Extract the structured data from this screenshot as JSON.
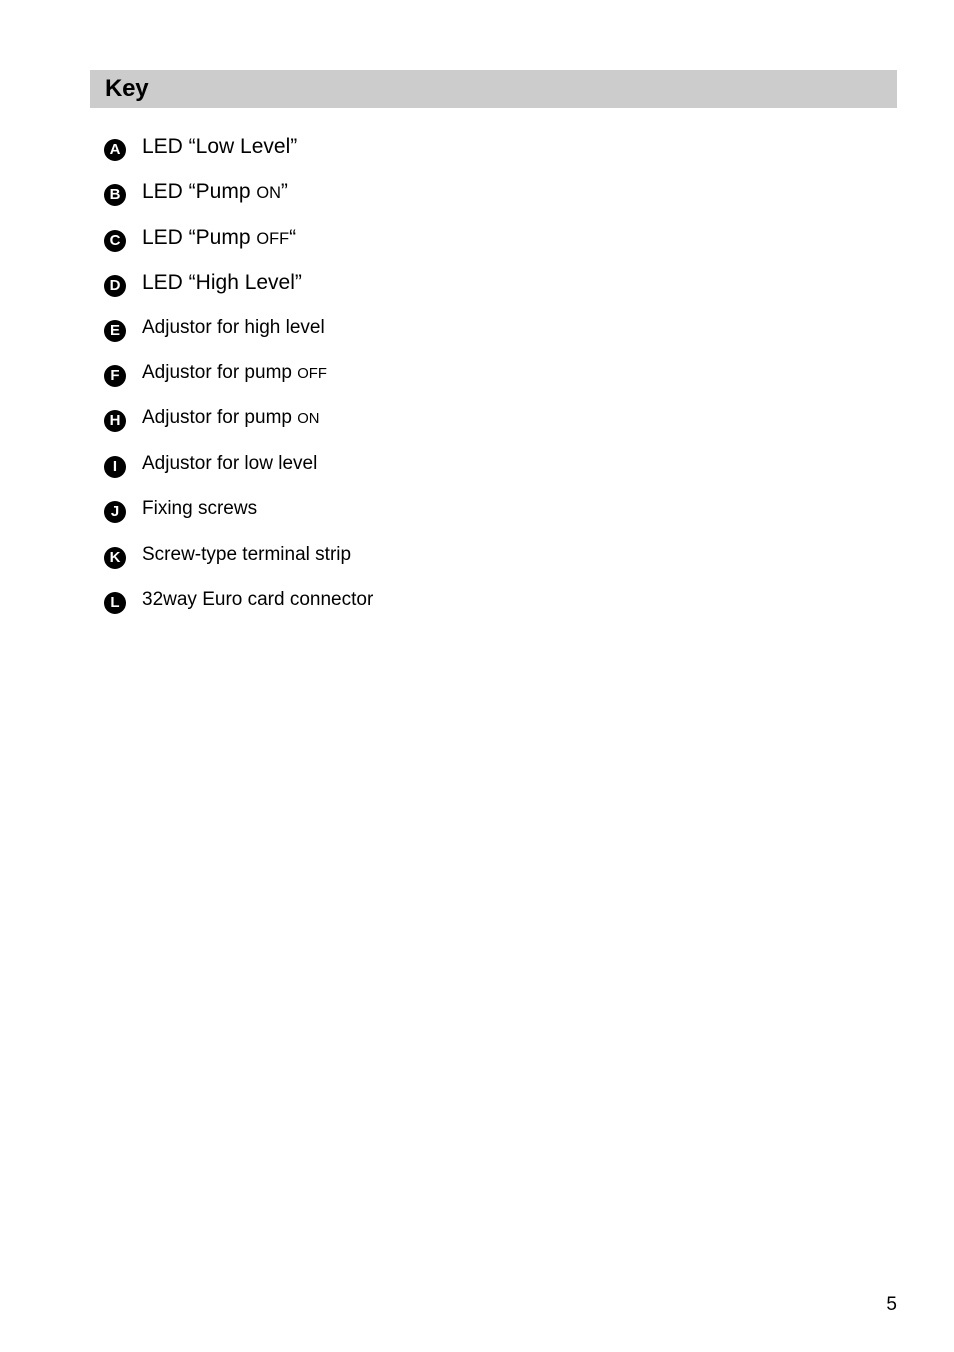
{
  "section": {
    "title": "Key",
    "header_bg": "#cccccc"
  },
  "key_list": [
    {
      "badge": "A",
      "size": "lg",
      "text_before": "LED “Low Level”",
      "smallcaps": "",
      "text_after": ""
    },
    {
      "badge": "B",
      "size": "lg",
      "text_before": "LED “Pump ",
      "smallcaps": "ON",
      "text_after": "”"
    },
    {
      "badge": "C",
      "size": "lg",
      "text_before": "LED “Pump ",
      "smallcaps": "OFF",
      "text_after": "“"
    },
    {
      "badge": "D",
      "size": "lg",
      "text_before": "LED “High Level”",
      "smallcaps": "",
      "text_after": ""
    },
    {
      "badge": "E",
      "size": "sm",
      "text_before": "Adjustor for high level",
      "smallcaps": "",
      "text_after": ""
    },
    {
      "badge": "F",
      "size": "sm",
      "text_before": "Adjustor for pump ",
      "smallcaps": "OFF",
      "text_after": ""
    },
    {
      "badge": "H",
      "size": "sm",
      "text_before": "Adjustor for pump ",
      "smallcaps": "ON",
      "text_after": ""
    },
    {
      "badge": "I",
      "size": "sm",
      "text_before": "Adjustor for low level",
      "smallcaps": "",
      "text_after": ""
    },
    {
      "badge": "J",
      "size": "sm",
      "text_before": "Fixing screws",
      "smallcaps": "",
      "text_after": ""
    },
    {
      "badge": "K",
      "size": "sm",
      "text_before": "Screw-type terminal strip",
      "smallcaps": "",
      "text_after": ""
    },
    {
      "badge": "L",
      "size": "sm",
      "text_before": "32way Euro card connector",
      "smallcaps": "",
      "text_after": ""
    }
  ],
  "footer": {
    "page_number": "5"
  }
}
